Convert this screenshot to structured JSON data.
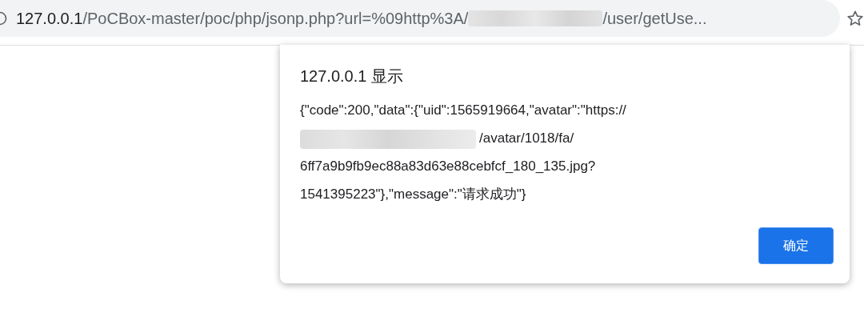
{
  "address_bar": {
    "host": "127.0.0.1",
    "path": "/PoCBox-master/poc/php/jsonp.php?url=%09http%3A/",
    "redacted": true,
    "rest": "/user/getUse..."
  },
  "dialog": {
    "title": "127.0.0.1 显示",
    "message_lines": [
      {
        "text": "{\"code\":200,\"data\":{\"uid\":1565919664,\"avatar\":\"https://",
        "redacted": false
      },
      {
        "text": "/avatar/1018/fa/",
        "redacted": true
      },
      {
        "text": "6ff7a9b9fb9ec88a83d63e88cebfcf_180_135.jpg?",
        "redacted": false
      },
      {
        "text": "1541395223\"},\"message\":\"请求成功\"}",
        "redacted": false
      }
    ],
    "button": "确定"
  }
}
